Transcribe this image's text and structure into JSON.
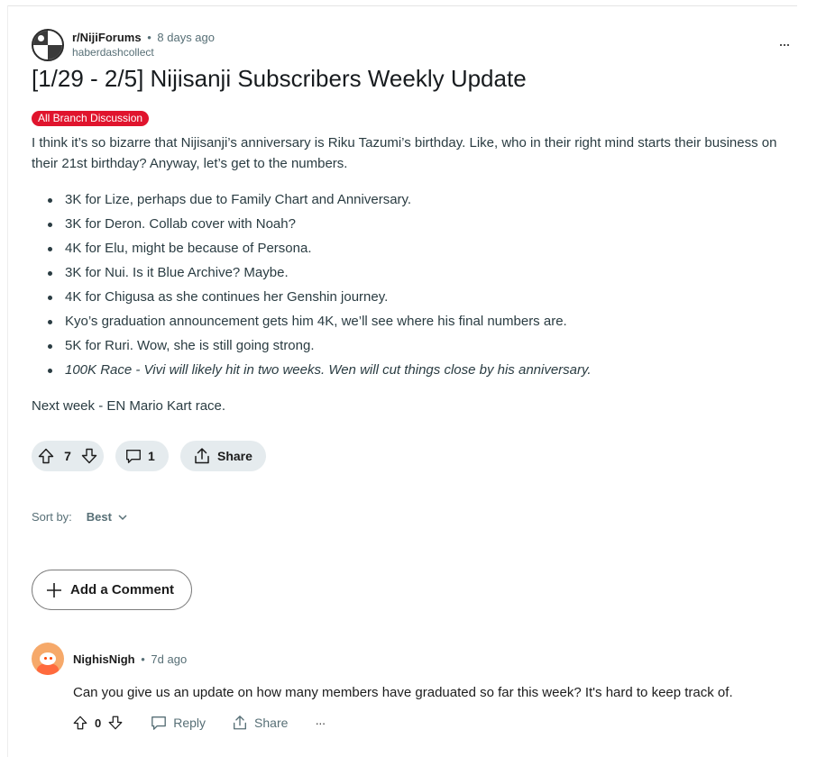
{
  "post": {
    "subreddit": "r/NijiForums",
    "separator": "•",
    "time": "8 days ago",
    "author": "haberdashcollect",
    "more_label": "···",
    "title": "[1/29 - 2/5] Nijisanji Subscribers Weekly Update",
    "flair": "All Branch Discussion",
    "flair_color": "#e0142d",
    "intro": "I think it’s so bizarre that Nijisanji’s anniversary is Riku Tazumi’s birthday. Like, who in their right mind starts their business on their 21st birthday? Anyway, let’s get to the numbers.",
    "bullets": [
      "3K for Lize, perhaps due to Family Chart and Anniversary.",
      "3K for Deron. Collab cover with Noah?",
      "4K for Elu, might be because of Persona.",
      "3K for Nui. Is it Blue Archive? Maybe.",
      "4K for Chigusa as she continues her Genshin journey.",
      "Kyo’s graduation announcement gets him 4K, we’ll see where his final numbers are.",
      "5K for Ruri. Wow, she is still going strong.",
      "100K Race - Vivi will likely hit in two weeks. Wen will cut things close by his anniversary."
    ],
    "outro": "Next week - EN Mario Kart race.",
    "votes": "7",
    "comments": "1",
    "share_label": "Share"
  },
  "sort": {
    "label": "Sort by:",
    "value": "Best"
  },
  "add_comment_label": "Add a Comment",
  "comment": {
    "author": "NighisNigh",
    "separator": "•",
    "time": "7d ago",
    "text": "Can you give us an update on how many members have graduated so far this week? It's hard to keep track of.",
    "votes": "0",
    "reply_label": "Reply",
    "share_label": "Share",
    "more_label": "···"
  },
  "icons": {
    "upvote": "upvote-arrow-icon",
    "downvote": "downvote-arrow-icon",
    "comment": "comment-bubble-icon",
    "share": "share-icon",
    "plus": "plus-icon",
    "chevron": "chevron-down-icon"
  }
}
